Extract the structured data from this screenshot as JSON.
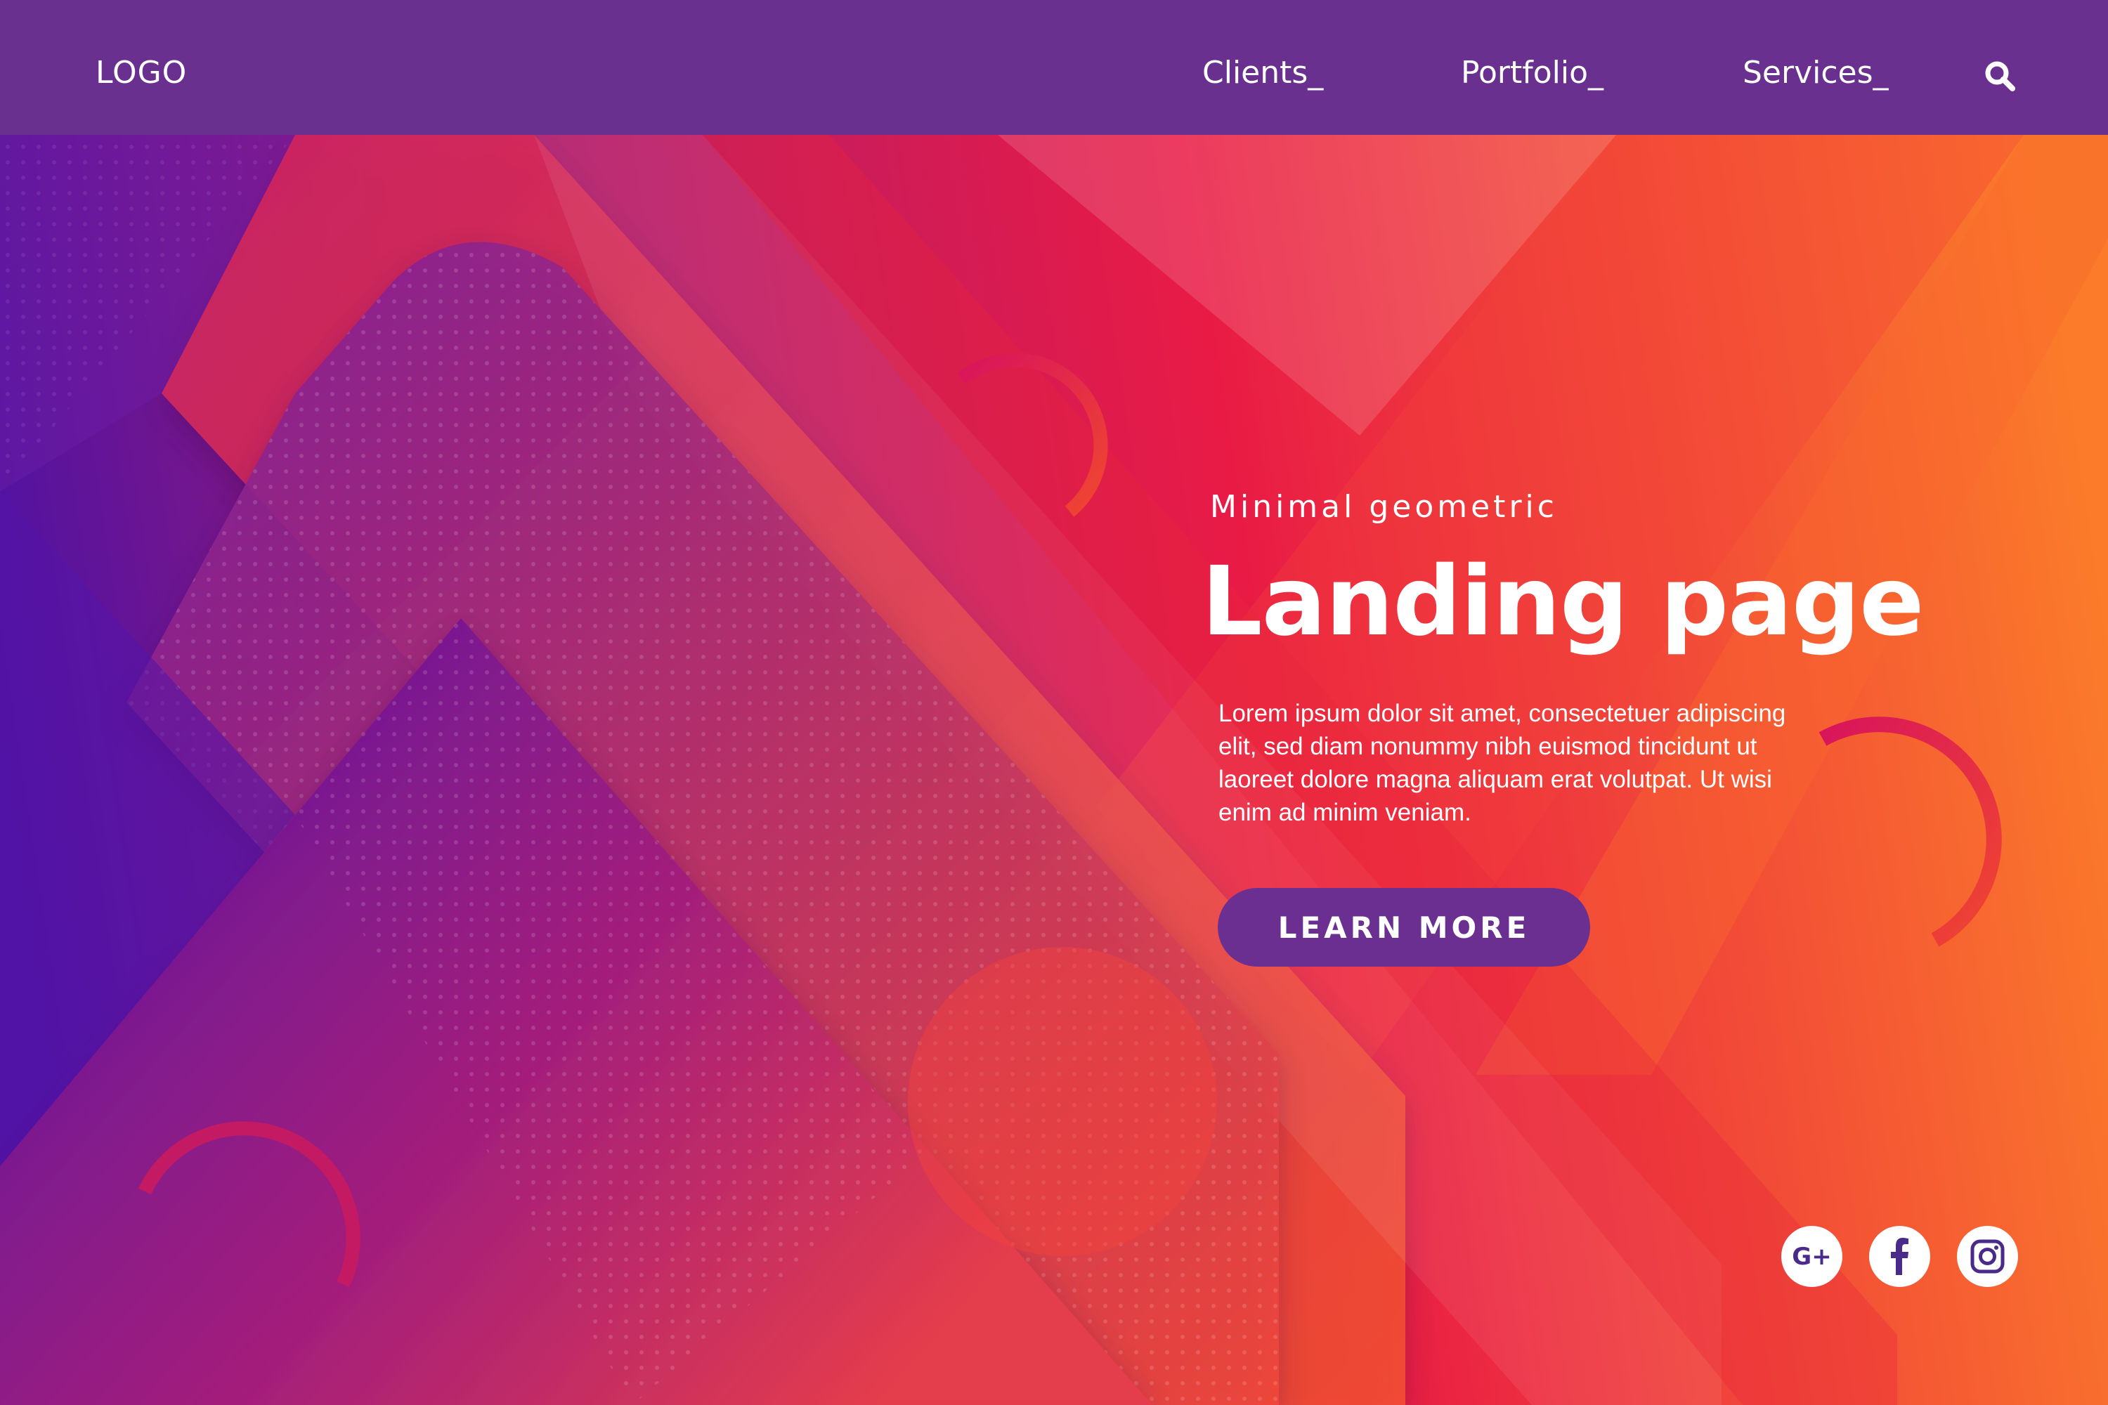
{
  "header": {
    "logo": "LOGO",
    "nav": [
      {
        "label": "Clients_"
      },
      {
        "label": "Portfolio_"
      },
      {
        "label": "Services_"
      }
    ],
    "search_icon": "search-icon"
  },
  "hero": {
    "subtitle": "Minimal geometric",
    "title": "Landing page",
    "description": "Lorem ipsum dolor sit amet, consectetuer adipiscing elit, sed diam nonummy nibh euismod tincidunt ut laoreet dolore magna aliquam erat volutpat. Ut wisi enim ad minim veniam.",
    "cta_label": "LEARN MORE"
  },
  "social": [
    {
      "label": "G+",
      "icon": "google-plus-icon"
    },
    {
      "icon": "facebook-icon"
    },
    {
      "icon": "instagram-icon"
    }
  ],
  "colors": {
    "nav_bar": "#69308f",
    "button": "#6a2f91",
    "icon": "#4a2a8a",
    "text": "#ffffff",
    "gradient_start": "#4a12a6",
    "gradient_mid": "#e8193f",
    "gradient_end": "#fb7a2c"
  }
}
